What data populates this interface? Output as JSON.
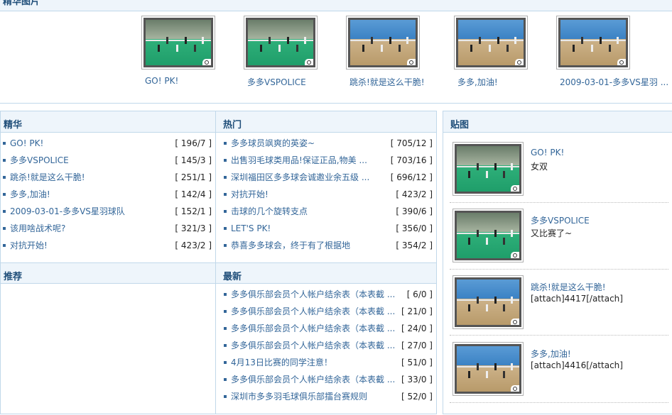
{
  "top": {
    "title": "精华图片",
    "pictures": [
      {
        "caption": "GO! PK!",
        "scene": "green"
      },
      {
        "caption": "多多VSPOLICE",
        "scene": "green"
      },
      {
        "caption": "跳杀!就是这么干脆!",
        "scene": "wood"
      },
      {
        "caption": "多多,加油!",
        "scene": "wood"
      },
      {
        "caption": "2009-03-01-多多VS星羽 ..."
      }
    ]
  },
  "jinghua": {
    "title": "精华",
    "items": [
      {
        "label": "GO! PK!",
        "count": "[ 196/7 ]"
      },
      {
        "label": "多多VSPOLICE",
        "count": "[ 145/3 ]"
      },
      {
        "label": "跳杀!就是这么干脆!",
        "count": "[ 251/1 ]"
      },
      {
        "label": "多多,加油!",
        "count": "[ 142/4 ]"
      },
      {
        "label": "2009-03-01-多多VS星羽球队",
        "count": "[ 152/1 ]"
      },
      {
        "label": "该用啥战术呢?",
        "count": "[ 321/3 ]"
      },
      {
        "label": "对抗开始!",
        "count": "[ 423/2 ]"
      }
    ]
  },
  "remen": {
    "title": "热门",
    "items": [
      {
        "label": "多多球员飒爽的英姿~",
        "count": "[ 705/12 ]"
      },
      {
        "label": "出售羽毛球类用品!保证正品,物美 ...",
        "count": "[ 703/16 ]"
      },
      {
        "label": "深圳福田区多多球会诚邀业余五级 ...",
        "count": "[ 696/12 ]"
      },
      {
        "label": "对抗开始!",
        "count": "[ 423/2 ]"
      },
      {
        "label": "击球的几个旋转支点",
        "count": "[ 390/6 ]"
      },
      {
        "label": "LET'S PK!",
        "count": "[ 356/0 ]"
      },
      {
        "label": "恭喜多多球会，终于有了根据地",
        "count": "[ 354/2 ]"
      }
    ]
  },
  "tuijian": {
    "title": "推荐"
  },
  "zuixin": {
    "title": "最新",
    "items": [
      {
        "label": "多多俱乐部会员个人帐户结余表（本表截 ...",
        "count": "[ 6/0 ]"
      },
      {
        "label": "多多俱乐部会员个人帐户结余表（本表截 ...",
        "count": "[ 21/0 ]"
      },
      {
        "label": "多多俱乐部会员个人帐户结余表（本表截 ...",
        "count": "[ 24/0 ]"
      },
      {
        "label": "多多俱乐部会员个人帐户结余表（本表截 ...",
        "count": "[ 27/0 ]"
      },
      {
        "label": "4月13日比赛的同学注意！",
        "count": "[ 51/0 ]"
      },
      {
        "label": "多多俱乐部会员个人帐户结余表（本表截 ...",
        "count": "[ 33/0 ]"
      },
      {
        "label": "深圳市多多羽毛球俱乐部擂台赛规则",
        "count": "[ 52/0 ]"
      }
    ]
  },
  "tietu": {
    "title": "贴图",
    "items": [
      {
        "title": "GO! PK!",
        "desc": "女双",
        "scene": "green"
      },
      {
        "title": "多多VSPOLICE",
        "desc": "又比赛了~",
        "scene": "green"
      },
      {
        "title": "跳杀!就是这么干脆!",
        "desc": "[attach]4417[/attach]",
        "scene": "wood"
      },
      {
        "title": "多多,加油!",
        "desc": "[attach]4416[/attach]",
        "scene": "wood"
      }
    ]
  },
  "colors": {
    "link": "#336699",
    "header_bg": "#eef5fb",
    "border": "#c1d8ea",
    "court_green": "#1f9e6a",
    "court_wood": "#b89a6a",
    "wall_blue": "#3b82c4"
  }
}
